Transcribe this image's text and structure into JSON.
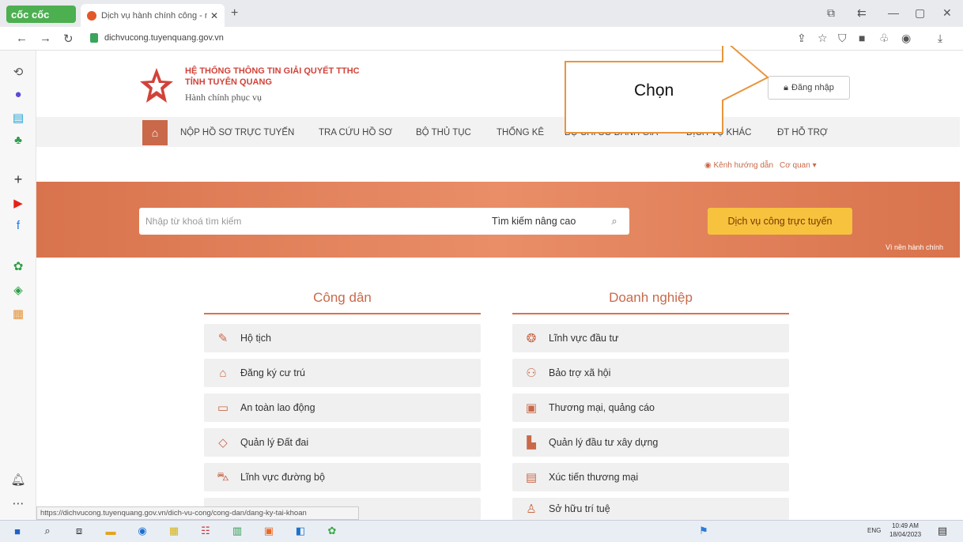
{
  "browser": {
    "logo_text": "cốc cốc",
    "tab_title": "Dịch vụ hành chính công - m",
    "new_tab": "+",
    "url": "dichvucong.tuyenquang.gov.vn",
    "window_controls": [
      "—",
      "▢",
      "✕"
    ]
  },
  "header": {
    "brand_line1": "HỆ THỐNG THÔNG TIN GIẢI QUYẾT TTHC",
    "brand_line2": "TỈNH TUYÊN QUANG",
    "brand_line3": "Hành chính phục vụ",
    "login_label": "Đăng nhập"
  },
  "menu": {
    "items": [
      "NỘP HỒ SƠ TRỰC TUYẾN",
      "TRA CỨU HỒ SƠ",
      "BỘ THỦ TỤC",
      "THỐNG KÊ",
      "BỘ CHỈ SỐ ĐÁNH GIÁ",
      "DỊCH VỤ KHÁC",
      "ĐT HỖ TRỢ"
    ]
  },
  "subbar": {
    "guide": "Kênh hướng dẫn",
    "agency": "Cơ quan ▾"
  },
  "search": {
    "placeholder": "Nhập từ khoá tìm kiếm",
    "advanced": "Tìm kiếm nâng cao",
    "online_services": "Dịch vụ công trực tuyến",
    "vision_text": "Vì nền hành chính"
  },
  "citizen": {
    "heading": "Công dân",
    "items": [
      "Hộ tịch",
      "Đăng ký cư trú",
      "An toàn lao động",
      "Quản lý Đất đai",
      "Lĩnh vực đường bộ"
    ]
  },
  "business": {
    "heading": "Doanh nghiệp",
    "items": [
      "Lĩnh vực đầu tư",
      "Bảo trợ xã hội",
      "Thương mại, quảng cáo",
      "Quản lý đầu tư xây dựng",
      "Xúc tiến thương mại",
      "Sở hữu trí tuệ"
    ]
  },
  "status_url": "https://dichvucong.tuyenquang.gov.vn/dich-vu-cong/cong-dan/dang-ky-tai-khoan",
  "annotation": {
    "text": "Chọn"
  },
  "taskbar": {
    "lang": "ENG",
    "time": "10:49 AM",
    "date": "18/04/2023"
  }
}
